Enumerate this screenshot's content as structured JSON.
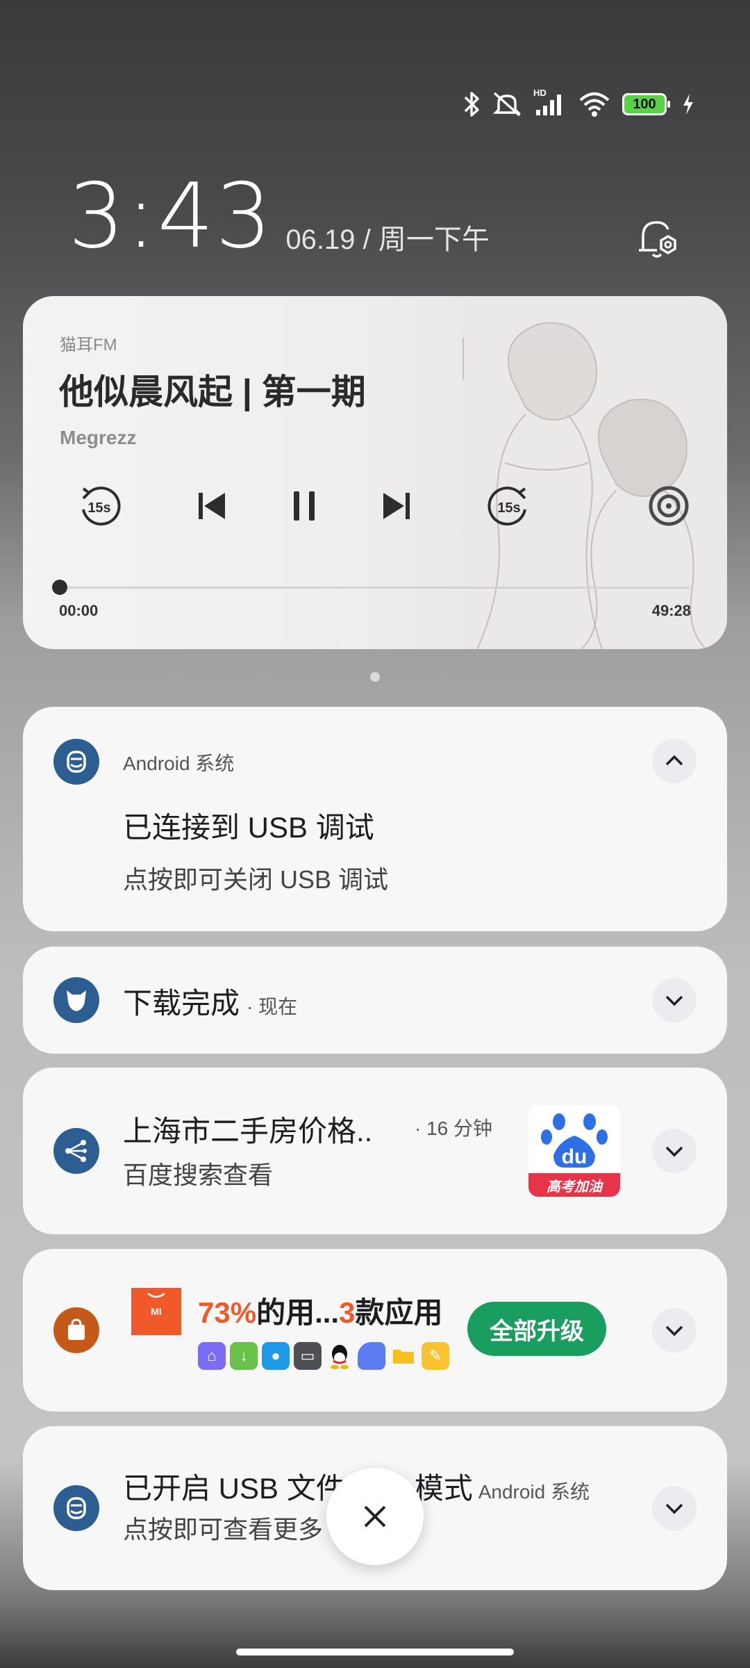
{
  "status_bar": {
    "icons": [
      "bluetooth-icon",
      "mute-icon",
      "hd-signal-icon",
      "wifi-icon",
      "battery-icon",
      "charging-icon"
    ],
    "signal_label": "HD",
    "battery_level": "100"
  },
  "lockscreen": {
    "time": "3:43",
    "date": "06.19 / 周一下午"
  },
  "media": {
    "app_name": "猫耳FM",
    "title": "他似晨风起 | 第一期",
    "artist": "Megrezz",
    "rewind_label": "15s",
    "forward_label": "15s",
    "progress": 0.0,
    "time_current": "00:00",
    "time_total": "49:28"
  },
  "notifications": [
    {
      "app": "Android 系统",
      "title": "已连接到 USB 调试",
      "text": "点按即可关闭 USB 调试",
      "icon": "android-system-icon",
      "color": "#2c5e91"
    },
    {
      "title": "下载完成",
      "time": "· 现在",
      "icon": "download-cat-icon",
      "color": "#2c5e91"
    },
    {
      "title": "上海市二手房价格..",
      "time": "· 16 分钟",
      "text": "百度搜索查看",
      "icon": "share-nodes-icon",
      "color": "#2c5e91",
      "thumb_label": "高考加油",
      "thumb_logo": "du"
    },
    {
      "title_pct": "73%",
      "title_mid": "的用...",
      "title_num": "3",
      "title_end": "款应用",
      "button": "全部升级",
      "icon": "app-store-bag-icon",
      "color": "#c45a1a",
      "promo_logo": "MI"
    },
    {
      "title": "已开启 USB 文件",
      "title_tail": "模式",
      "app": "Android 系统",
      "text": "点按即可查看更多",
      "icon": "android-system-icon",
      "color": "#2c5e91"
    }
  ],
  "colors": {
    "accent_orange": "#f05a2a",
    "upgrade_green": "#1a9e5f"
  }
}
